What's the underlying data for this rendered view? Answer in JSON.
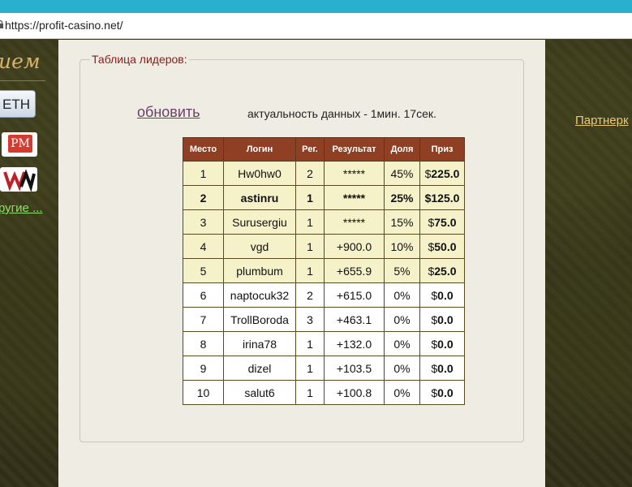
{
  "browser": {
    "url": "https://profit-casino.net/"
  },
  "left_panel": {
    "brand": "ием",
    "button_label": "ЕТН",
    "pm_logo": "PM",
    "other_link": "ругие ..."
  },
  "right_panel": {
    "partner_link": "Партнерк"
  },
  "leaderboard": {
    "legend": "Таблица лидеров:",
    "refresh_label": "обновить",
    "freshness": "актуальность данных - 1мин. 17сек.",
    "columns": [
      "Место",
      "Логин",
      "Рег.",
      "Результат",
      "Доля",
      "Приз"
    ],
    "rows": [
      {
        "place": "1",
        "login": "Hw0hw0",
        "reg": "2",
        "result": "*****",
        "share": "45%",
        "prize_cur": "$",
        "prize": "225.0"
      },
      {
        "place": "2",
        "login": "astinru",
        "reg": "1",
        "result": "*****",
        "share": "25%",
        "prize_cur": "$",
        "prize": "125.0"
      },
      {
        "place": "3",
        "login": "Surusergiu",
        "reg": "1",
        "result": "*****",
        "share": "15%",
        "prize_cur": "$",
        "prize": "75.0"
      },
      {
        "place": "4",
        "login": "vgd",
        "reg": "1",
        "result": "+900.0",
        "share": "10%",
        "prize_cur": "$",
        "prize": "50.0"
      },
      {
        "place": "5",
        "login": "plumbum",
        "reg": "1",
        "result": "+655.9",
        "share": "5%",
        "prize_cur": "$",
        "prize": "25.0"
      },
      {
        "place": "6",
        "login": "naptocuk32",
        "reg": "2",
        "result": "+615.0",
        "share": "0%",
        "prize_cur": "$",
        "prize": "0.0"
      },
      {
        "place": "7",
        "login": "TrollBoroda",
        "reg": "3",
        "result": "+463.1",
        "share": "0%",
        "prize_cur": "$",
        "prize": "0.0"
      },
      {
        "place": "8",
        "login": "irina78",
        "reg": "1",
        "result": "+132.0",
        "share": "0%",
        "prize_cur": "$",
        "prize": "0.0"
      },
      {
        "place": "9",
        "login": "dizel",
        "reg": "1",
        "result": "+103.5",
        "share": "0%",
        "prize_cur": "$",
        "prize": "0.0"
      },
      {
        "place": "10",
        "login": "salut6",
        "reg": "1",
        "result": "+100.8",
        "share": "0%",
        "prize_cur": "$",
        "prize": "0.0"
      }
    ]
  }
}
